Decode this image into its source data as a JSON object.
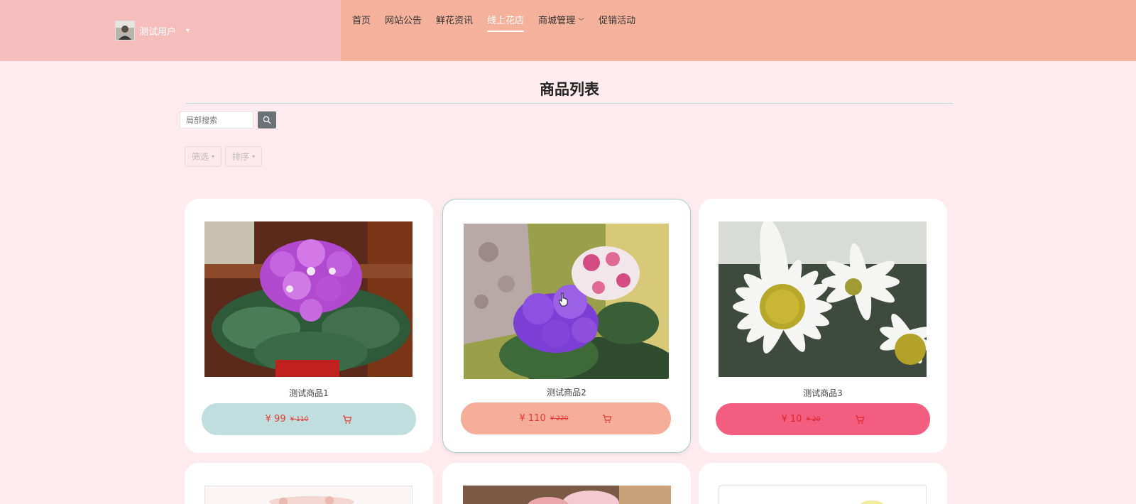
{
  "header": {
    "user": {
      "name": "测试用户"
    },
    "nav": [
      {
        "label": "首页",
        "active": false,
        "dropdown": false
      },
      {
        "label": "网站公告",
        "active": false,
        "dropdown": false
      },
      {
        "label": "鲜花资讯",
        "active": false,
        "dropdown": false
      },
      {
        "label": "线上花店",
        "active": true,
        "dropdown": false
      },
      {
        "label": "商城管理",
        "active": false,
        "dropdown": true
      },
      {
        "label": "促销活动",
        "active": false,
        "dropdown": false
      }
    ]
  },
  "main": {
    "title": "商品列表",
    "search": {
      "placeholder": "局部搜索"
    },
    "filters": {
      "filter_label": "筛选",
      "sort_label": "排序"
    },
    "products": [
      {
        "name": "测试商品1",
        "price": "¥ 99",
        "old_price": "¥ 110",
        "bar_color": "#bfdedd"
      },
      {
        "name": "测试商品2",
        "price": "¥ 110",
        "old_price": "¥ 220",
        "bar_color": "#f4ad98"
      },
      {
        "name": "测试商品3",
        "price": "¥ 10",
        "old_price": "¥ 20",
        "bar_color": "#f25d80"
      }
    ]
  }
}
